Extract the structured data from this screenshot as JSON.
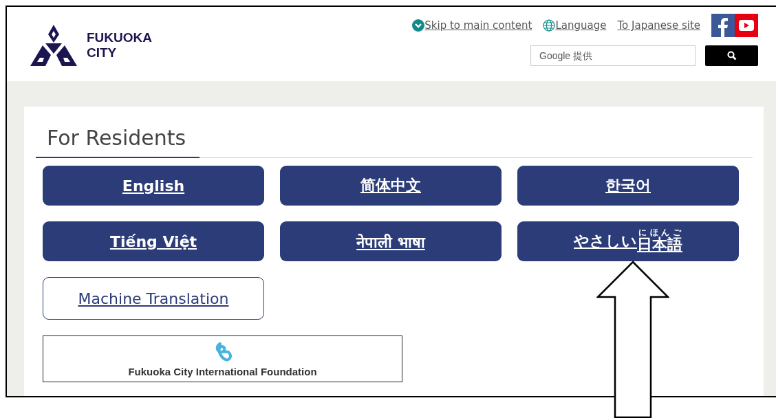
{
  "header": {
    "logo": {
      "line1": "FUKUOKA",
      "line2": "CITY"
    },
    "links": [
      {
        "kind": "skip",
        "label": "Skip to main content"
      },
      {
        "kind": "language",
        "label": "Language"
      },
      {
        "kind": "plain",
        "label": "To Japanese site"
      }
    ],
    "search": {
      "placeholder": "Google 提供"
    }
  },
  "section": {
    "title": "For Residents",
    "buttons": [
      {
        "kind": "filled",
        "label": "English"
      },
      {
        "kind": "filled",
        "label": "简体中文"
      },
      {
        "kind": "filled",
        "label": "한국어"
      },
      {
        "kind": "filled",
        "label": "Tiếng Việt"
      },
      {
        "kind": "filled",
        "label": "नेपाली भाषा"
      },
      {
        "kind": "ruby",
        "label": "やさしい",
        "base": "日本語",
        "reading": "にほんご"
      },
      {
        "kind": "outline",
        "label": "Machine Translation"
      }
    ],
    "banner": {
      "label": "Fukuoka City International Foundation"
    }
  }
}
